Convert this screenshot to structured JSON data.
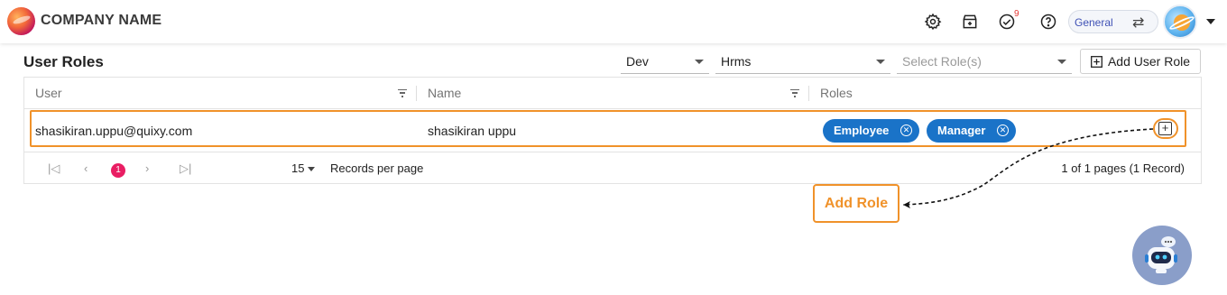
{
  "header": {
    "company_name": "COMPANY NAME",
    "notification_count": "9",
    "workspace_label": "General",
    "icons": [
      "settings-icon",
      "store-icon",
      "tasks-check-icon",
      "help-icon",
      "swap-icon",
      "avatar",
      "caret-down-icon"
    ]
  },
  "page": {
    "title": "User Roles",
    "filters": {
      "environment": "Dev",
      "application": "Hrms",
      "role_placeholder": "Select Role(s)"
    },
    "add_user_role_label": "Add User Role"
  },
  "table": {
    "columns": [
      "User",
      "Name",
      "Roles"
    ],
    "rows": [
      {
        "user": "shasikiran.uppu@quixy.com",
        "name": "shasikiran uppu",
        "roles": [
          "Employee",
          "Manager"
        ]
      }
    ]
  },
  "pager": {
    "current_page": "1",
    "page_size": "15",
    "records_per_page_label": "Records per page",
    "info": "1 of 1 pages (1 Record)"
  },
  "callout": {
    "label": "Add Role"
  },
  "colors": {
    "accent_orange": "#f0922a",
    "chip_blue": "#1a73c8",
    "page_pink": "#e91e63"
  }
}
